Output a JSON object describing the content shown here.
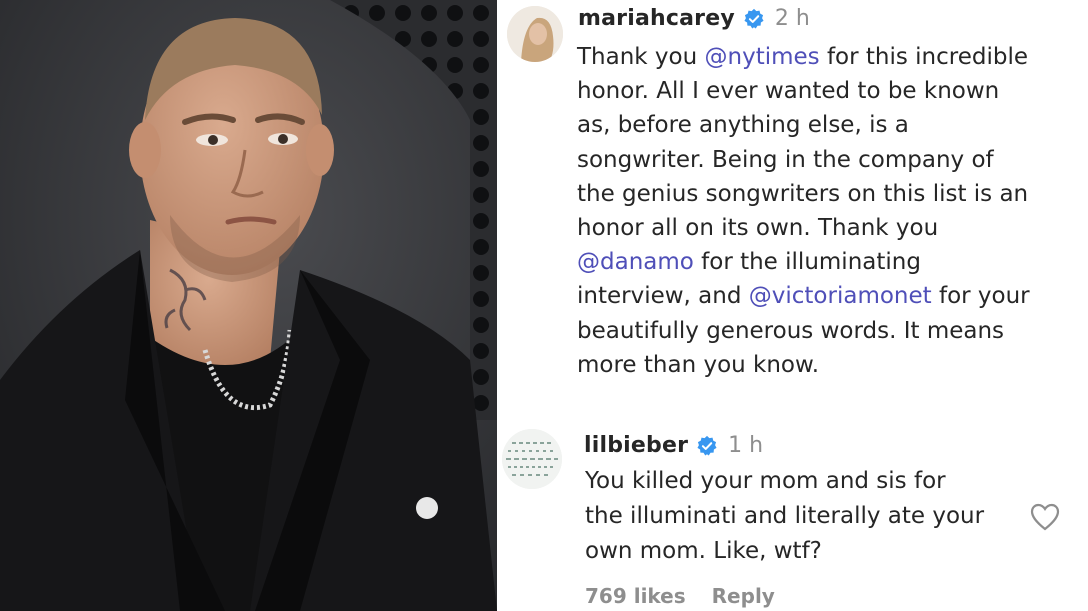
{
  "colors": {
    "text": "#262626",
    "muted": "#8e8e8e",
    "mention": "#4f4fb8",
    "verified": "#3897f0"
  },
  "photo": {
    "alt_subject": "man in black suit with neck tattoo and pearl necklace"
  },
  "comment": {
    "username": "mariahcarey",
    "time": "2 h",
    "lines": [
      [
        {
          "t": "Thank you "
        },
        {
          "t": "@nytimes",
          "m": true
        },
        {
          "t": " for this incredible"
        }
      ],
      [
        {
          "t": "honor. All I ever wanted to be known"
        }
      ],
      [
        {
          "t": "as, before anything else, is a"
        }
      ],
      [
        {
          "t": "songwriter. Being in the company of"
        }
      ],
      [
        {
          "t": "the genius songwriters on this list is an"
        }
      ],
      [
        {
          "t": "honor all on its own. Thank you"
        }
      ],
      [
        {
          "t": "@danamo",
          "m": true
        },
        {
          "t": " for the illuminating"
        }
      ],
      [
        {
          "t": "interview, and "
        },
        {
          "t": "@victoriamonet",
          "m": true
        },
        {
          "t": " for your"
        }
      ],
      [
        {
          "t": "beautifully generous words. It means"
        }
      ],
      [
        {
          "t": "more than you know."
        }
      ]
    ]
  },
  "reply": {
    "username": "lilbieber",
    "time": "1 h",
    "lines": [
      "You killed your mom and sis for",
      "the illuminati and literally ate your",
      "own mom. Like, wtf?"
    ],
    "likes": "769 likes",
    "reply_label": "Reply"
  }
}
